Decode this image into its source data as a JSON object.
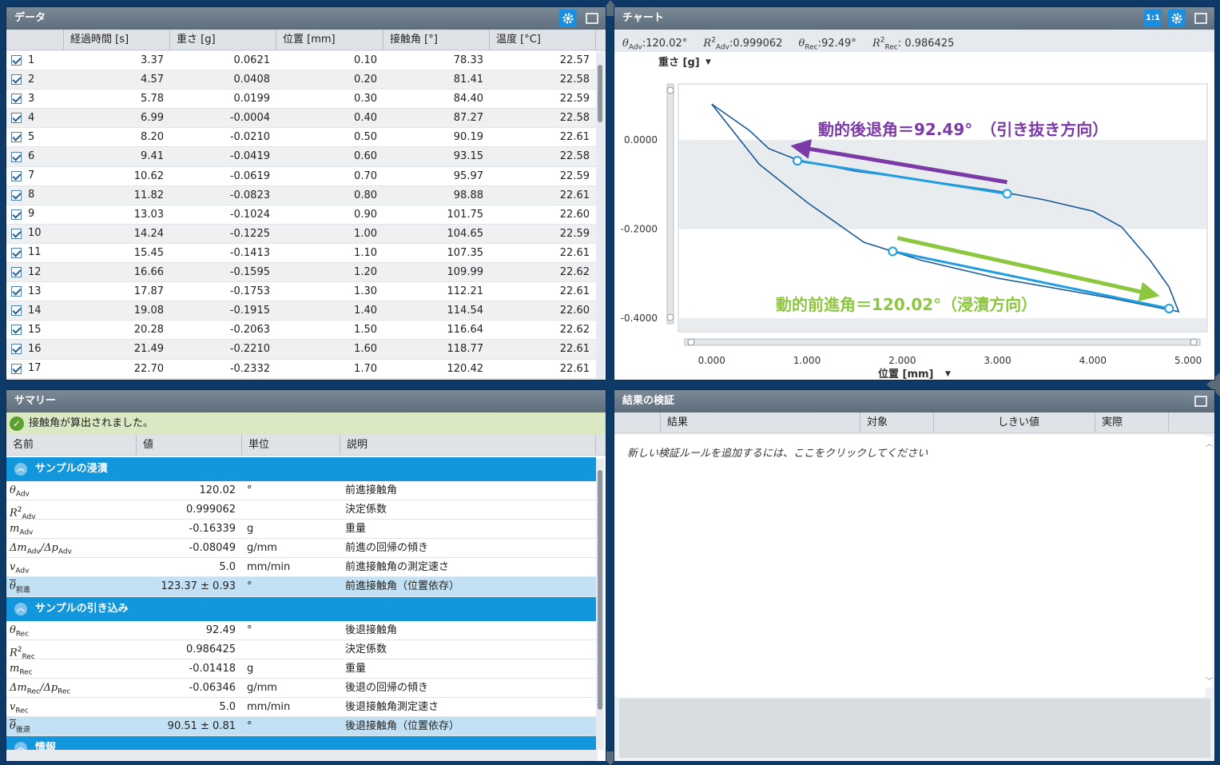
{
  "data_panel": {
    "title": "データ",
    "columns": [
      "経過時間 [s]",
      "重さ [g]",
      "位置 [mm]",
      "接触角 [°]",
      "温度 [°C]"
    ],
    "rows": [
      {
        "id": "1",
        "time": "3.37",
        "mass": "0.0621",
        "pos": "0.10",
        "angle": "78.33",
        "temp": "22.57"
      },
      {
        "id": "2",
        "time": "4.57",
        "mass": "0.0408",
        "pos": "0.20",
        "angle": "81.41",
        "temp": "22.58"
      },
      {
        "id": "3",
        "time": "5.78",
        "mass": "0.0199",
        "pos": "0.30",
        "angle": "84.40",
        "temp": "22.59"
      },
      {
        "id": "4",
        "time": "6.99",
        "mass": "-0.0004",
        "pos": "0.40",
        "angle": "87.27",
        "temp": "22.58"
      },
      {
        "id": "5",
        "time": "8.20",
        "mass": "-0.0210",
        "pos": "0.50",
        "angle": "90.19",
        "temp": "22.61"
      },
      {
        "id": "6",
        "time": "9.41",
        "mass": "-0.0419",
        "pos": "0.60",
        "angle": "93.15",
        "temp": "22.58"
      },
      {
        "id": "7",
        "time": "10.62",
        "mass": "-0.0619",
        "pos": "0.70",
        "angle": "95.97",
        "temp": "22.59"
      },
      {
        "id": "8",
        "time": "11.82",
        "mass": "-0.0823",
        "pos": "0.80",
        "angle": "98.88",
        "temp": "22.61"
      },
      {
        "id": "9",
        "time": "13.03",
        "mass": "-0.1024",
        "pos": "0.90",
        "angle": "101.75",
        "temp": "22.60"
      },
      {
        "id": "10",
        "time": "14.24",
        "mass": "-0.1225",
        "pos": "1.00",
        "angle": "104.65",
        "temp": "22.59"
      },
      {
        "id": "11",
        "time": "15.45",
        "mass": "-0.1413",
        "pos": "1.10",
        "angle": "107.35",
        "temp": "22.61"
      },
      {
        "id": "12",
        "time": "16.66",
        "mass": "-0.1595",
        "pos": "1.20",
        "angle": "109.99",
        "temp": "22.62"
      },
      {
        "id": "13",
        "time": "17.87",
        "mass": "-0.1753",
        "pos": "1.30",
        "angle": "112.21",
        "temp": "22.61"
      },
      {
        "id": "14",
        "time": "19.08",
        "mass": "-0.1915",
        "pos": "1.40",
        "angle": "114.54",
        "temp": "22.60"
      },
      {
        "id": "15",
        "time": "20.28",
        "mass": "-0.2063",
        "pos": "1.50",
        "angle": "116.64",
        "temp": "22.62"
      },
      {
        "id": "16",
        "time": "21.49",
        "mass": "-0.2210",
        "pos": "1.60",
        "angle": "118.77",
        "temp": "22.61"
      },
      {
        "id": "17",
        "time": "22.70",
        "mass": "-0.2332",
        "pos": "1.70",
        "angle": "120.42",
        "temp": "22.61"
      }
    ]
  },
  "chart_panel": {
    "title": "チャート",
    "ratio_button": "1:1",
    "stats": {
      "adv_angle": ":120.02°",
      "adv_r2": ":0.999062",
      "rec_angle": ":92.49°",
      "rec_r2": ": 0.986425"
    },
    "y_axis_label": "重さ [g]",
    "x_axis_label": "位置 [mm]",
    "annotation_receding": "動的後退角＝92.49°　（引き抜き方向）",
    "annotation_advancing": "動的前進角＝120.02°（浸漬方向）",
    "x_ticks": [
      "0.000",
      "1.000",
      "2.000",
      "3.000",
      "4.000",
      "5.000"
    ],
    "y_ticks": [
      "0.0000",
      "-0.2000",
      "-0.4000"
    ],
    "colors": {
      "curve": "#1a5a9a",
      "fit": "#1f9de0",
      "receding_arrow": "#7b3aa6",
      "advancing_arrow": "#8dc63f"
    }
  },
  "chart_data": {
    "type": "line",
    "xlabel": "位置 [mm]",
    "ylabel": "重さ [g]",
    "xlim": [
      -0.35,
      5.2
    ],
    "ylim": [
      -0.43,
      0.125
    ],
    "x_ticks": [
      0,
      1,
      2,
      3,
      4,
      5
    ],
    "y_ticks": [
      0,
      -0.2,
      -0.4
    ],
    "series": [
      {
        "points": [
          [
            0.0,
            0.08
          ],
          [
            0.4,
            0.02
          ],
          [
            0.6,
            -0.02
          ],
          [
            0.9,
            -0.045
          ],
          [
            1.5,
            -0.07
          ],
          [
            2.2,
            -0.09
          ],
          [
            3.0,
            -0.115
          ],
          [
            3.5,
            -0.135
          ],
          [
            4.0,
            -0.16
          ],
          [
            4.3,
            -0.195
          ],
          [
            4.6,
            -0.27
          ],
          [
            4.8,
            -0.33
          ],
          [
            4.9,
            -0.385
          ],
          [
            4.78,
            -0.38
          ],
          [
            4.2,
            -0.355
          ],
          [
            3.0,
            -0.31
          ],
          [
            2.2,
            -0.27
          ],
          [
            1.6,
            -0.23
          ],
          [
            1.0,
            -0.14
          ],
          [
            0.5,
            -0.055
          ],
          [
            0.0,
            0.08
          ]
        ]
      },
      {
        "points": [
          [
            0.9,
            -0.047
          ],
          [
            3.1,
            -0.121
          ]
        ]
      },
      {
        "points": [
          [
            1.9,
            -0.25
          ],
          [
            4.8,
            -0.378
          ]
        ]
      }
    ],
    "annotations": [
      "動的後退角＝92.49°　（引き抜き方向）",
      "動的前進角＝120.02°（浸漬方向）"
    ]
  },
  "summary_panel": {
    "title": "サマリー",
    "status": "接触角が算出されました。",
    "columns": [
      "名前",
      "値",
      "単位",
      "説明"
    ],
    "section_advancing": "サンプルの浸漬",
    "section_receding": "サンプルの引き込み",
    "section_next": "情報",
    "adv_rows": [
      {
        "sym": "θ",
        "sub": "Adv",
        "value": "120.02",
        "unit": "°",
        "desc": "前進接触角"
      },
      {
        "sym": "R",
        "sub": "Adv",
        "value": "0.999062",
        "unit": "",
        "desc": "決定係数"
      },
      {
        "sym": "m",
        "sub": "Adv",
        "value": "-0.16339",
        "unit": "g",
        "desc": "重量"
      },
      {
        "sym": "Δm",
        "sub": "Adv",
        "value": "-0.08049",
        "unit": "g/mm",
        "desc": "前進の回帰の傾き"
      },
      {
        "sym": "v",
        "sub": "Adv",
        "value": "5.0",
        "unit": "mm/min",
        "desc": "前進接触角の測定速さ"
      },
      {
        "sym": "θ",
        "sub": "前進",
        "value": "123.37  ± 0.93",
        "unit": "°",
        "desc": "前進接触角（位置依存）"
      }
    ],
    "rec_rows": [
      {
        "sym": "θ",
        "sub": "Rec",
        "value": "92.49",
        "unit": "°",
        "desc": "後退接触角"
      },
      {
        "sym": "R",
        "sub": "Rec",
        "value": "0.986425",
        "unit": "",
        "desc": "決定係数"
      },
      {
        "sym": "m",
        "sub": "Rec",
        "value": "-0.01418",
        "unit": "g",
        "desc": "重量"
      },
      {
        "sym": "Δm",
        "sub": "Rec",
        "value": "-0.06346",
        "unit": "g/mm",
        "desc": "後退の回帰の傾き"
      },
      {
        "sym": "v",
        "sub": "Rec",
        "value": "5.0",
        "unit": "mm/min",
        "desc": "後退接触角測定速さ"
      },
      {
        "sym": "θ",
        "sub": "後退",
        "value": "90.51  ± 0.81",
        "unit": "°",
        "desc": "後退接触角（位置依存）"
      }
    ]
  },
  "verify_panel": {
    "title": "結果の検証",
    "columns": [
      "結果",
      "対象",
      "しきい値",
      "実際"
    ],
    "hint": "新しい検証ルールを追加するには、ここをクリックしてください"
  }
}
